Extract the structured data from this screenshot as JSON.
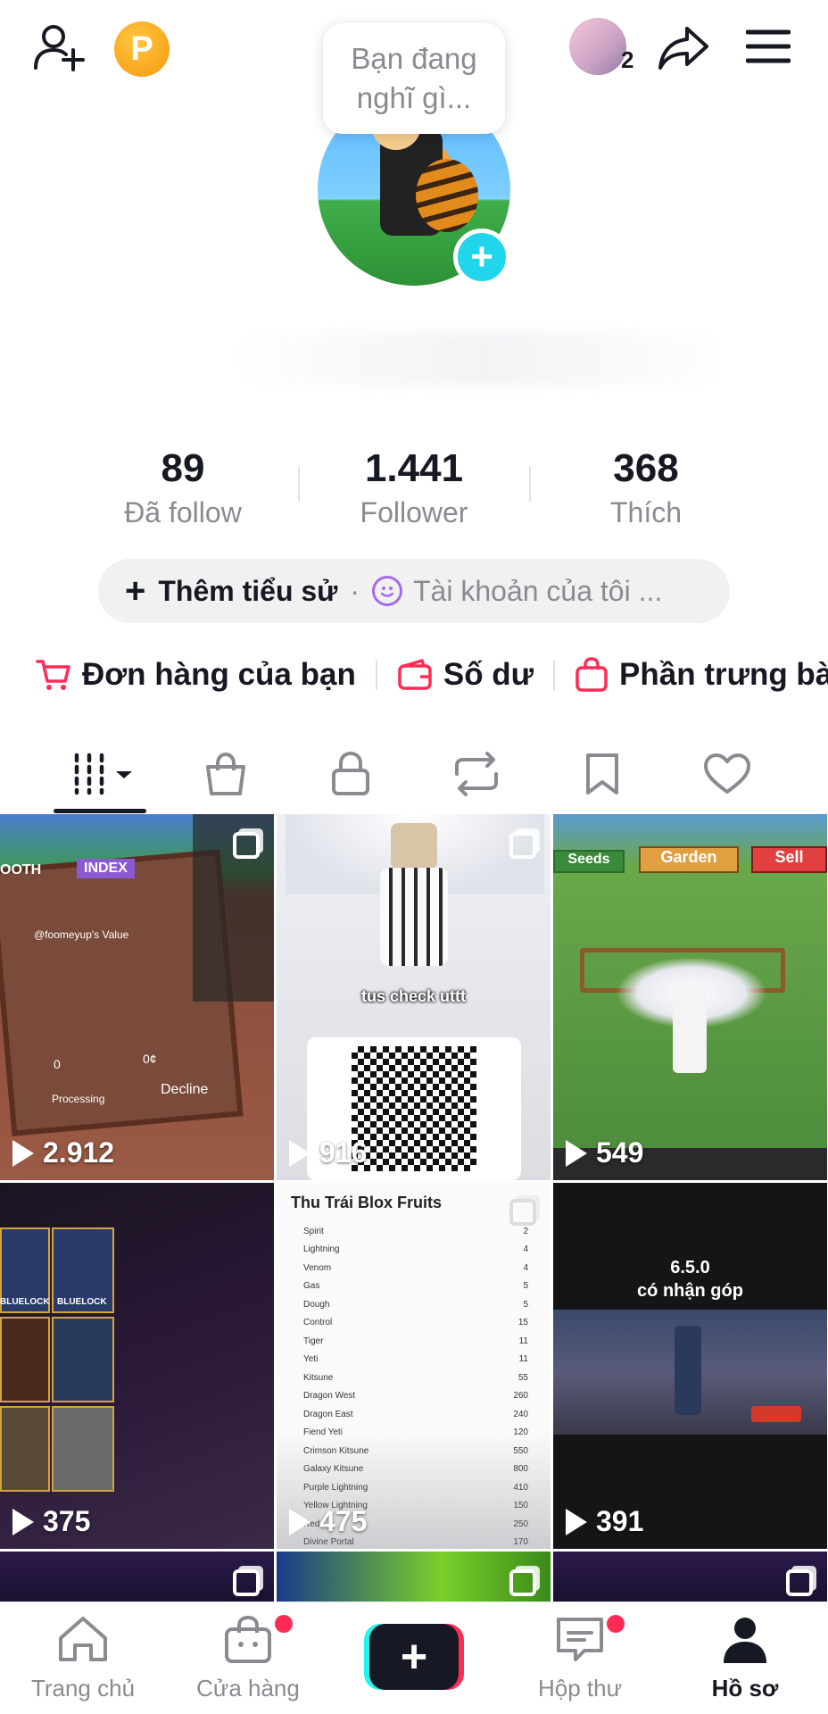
{
  "bubble_text_line1": "Bạn đang",
  "bubble_text_line2": "nghĩ gì...",
  "coin_letter": "P",
  "friend_count": "2",
  "stats": [
    {
      "num": "89",
      "label": "Đã follow"
    },
    {
      "num": "1.441",
      "label": "Follower"
    },
    {
      "num": "368",
      "label": "Thích"
    }
  ],
  "bio": {
    "add_label": "Thêm tiểu sử",
    "separator": "·",
    "account_label": "Tài khoản của tôi ..."
  },
  "shortcuts": [
    {
      "label": "Đơn hàng của bạn",
      "icon": "cart-icon"
    },
    {
      "label": "Số dư",
      "icon": "wallet-icon"
    },
    {
      "label": "Phần trưng bà",
      "icon": "shopping-bag-icon"
    }
  ],
  "grid": {
    "views": [
      "2.912",
      "916",
      "549",
      "375",
      "475",
      "391"
    ],
    "cell1_labels": [
      "OOTH",
      "INDEX",
      "@foomeyup's Value",
      "0",
      "0¢",
      "Processing",
      "Decline"
    ],
    "cell2_caption": "tus check uttt",
    "cell3_buttons": [
      "Seeds",
      "Garden",
      "Sell"
    ],
    "cell4_labels": [
      "BLUELOCK",
      "BLUELOCK"
    ],
    "cell5_title": "Thu Trái Blox Fruits",
    "cell5_list": [
      [
        "Spirit",
        "2"
      ],
      [
        "Lightning",
        "4"
      ],
      [
        "Venom",
        "4"
      ],
      [
        "Gas",
        "5"
      ],
      [
        "Dough",
        "5"
      ],
      [
        "Control",
        "15"
      ],
      [
        "Tiger",
        "11"
      ],
      [
        "Yeti",
        "11"
      ],
      [
        "Kitsune",
        "55"
      ],
      [
        "Dragon West",
        "260"
      ],
      [
        "Dragon East",
        "240"
      ],
      [
        "Fiend Yeti",
        "120"
      ],
      [
        "Crimson Kitsune",
        "550"
      ],
      [
        "Galaxy Kitsune",
        "800"
      ],
      [
        "Purple Lightning",
        "410"
      ],
      [
        "Yellow Lightning",
        "150"
      ],
      [
        "Red...",
        "250"
      ],
      [
        "Divine Portal",
        "170"
      ]
    ],
    "cell6_line1": "6.5.0",
    "cell6_line2": "có nhận góp"
  },
  "bottom_nav": [
    {
      "label": "Trang chủ",
      "icon": "home-icon"
    },
    {
      "label": "Cửa hàng",
      "icon": "shop-bag-icon"
    },
    {
      "label": "",
      "icon": "create-plus-icon"
    },
    {
      "label": "Hộp thư",
      "icon": "inbox-icon"
    },
    {
      "label": "Hồ sơ",
      "icon": "profile-icon"
    }
  ],
  "colors": {
    "accent_red": "#fe2c55",
    "accent_cyan": "#20d5ec",
    "text_primary": "#161823",
    "text_secondary": "#8a8b91"
  }
}
